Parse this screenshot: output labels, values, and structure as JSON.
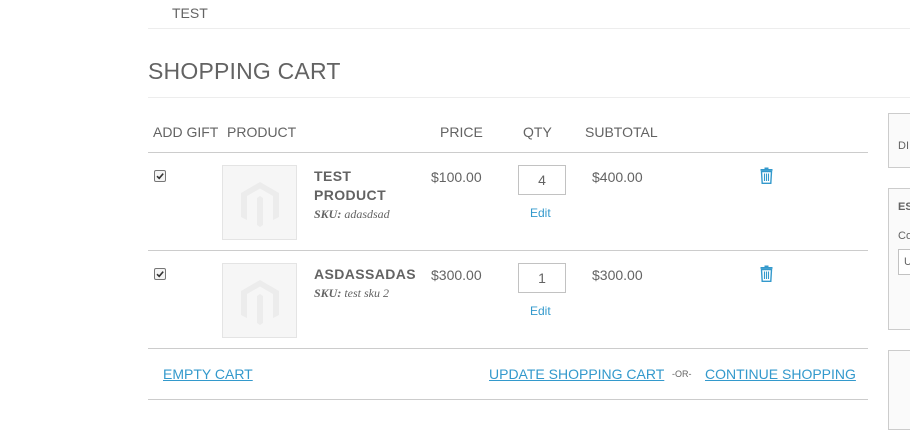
{
  "breadcrumb": {
    "current": "TEST"
  },
  "page_title": "SHOPPING CART",
  "table": {
    "headers": {
      "gift": "ADD GIFT",
      "product": "PRODUCT",
      "price": "PRICE",
      "qty": "QTY",
      "subtotal": "SUBTOTAL"
    }
  },
  "items": [
    {
      "name": "TEST PRODUCT",
      "sku_label": "SKU:",
      "sku": "adasdsad",
      "price": "$100.00",
      "qty": "4",
      "edit_label": "Edit",
      "subtotal": "$400.00",
      "gift_checked": true,
      "remove_icon": "trash-icon"
    },
    {
      "name": "ASDASSADAS",
      "sku_label": "SKU:",
      "sku": "test sku 2",
      "price": "$300.00",
      "qty": "1",
      "edit_label": "Edit",
      "subtotal": "$300.00",
      "gift_checked": true,
      "remove_icon": "trash-icon"
    }
  ],
  "actions": {
    "empty_cart": "EMPTY CART",
    "update_cart": "UPDATE SHOPPING CART",
    "or": "-OR-",
    "continue": "CONTINUE SHOPPING"
  },
  "sidebar": {
    "box1_text": "DI",
    "box2_title": "ES",
    "box2_label": "Co",
    "box2_select": "U"
  },
  "colors": {
    "link": "#3399cc",
    "text": "#636363",
    "border": "#cccccc"
  }
}
